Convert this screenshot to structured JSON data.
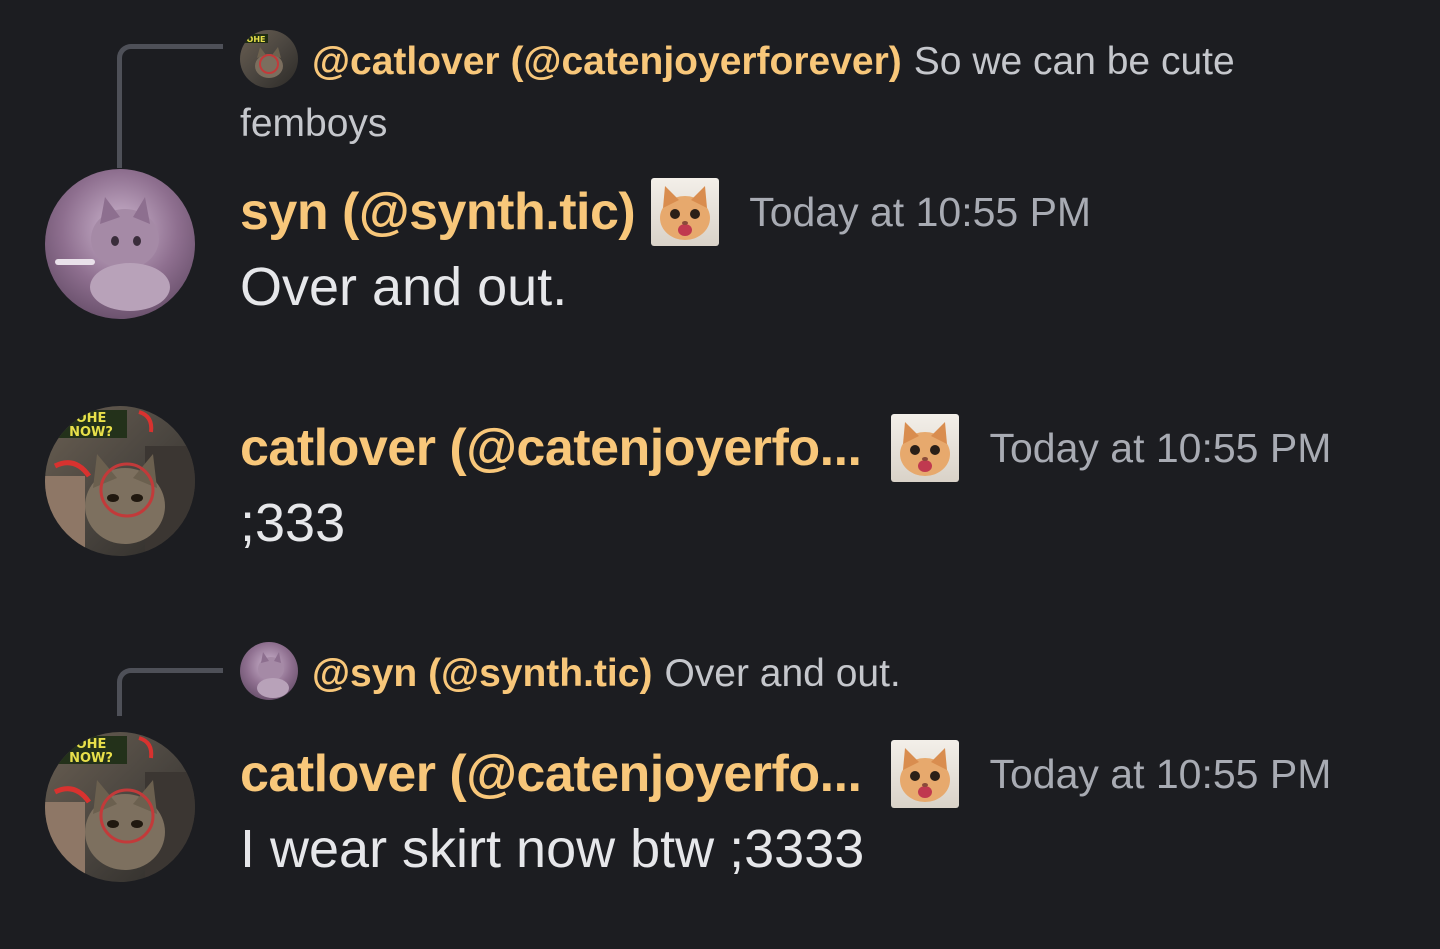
{
  "messages": [
    {
      "reply": {
        "author": "@catlover (@catenjoyerforever)",
        "text": "So we can be cute femboys"
      },
      "author": "syn (@synth.tic)",
      "timestamp": "Today at 10:55 PM",
      "text": "Over and out.",
      "avatar_icon": "kitten-avatar-icon",
      "role_icon": "cat-face-icon"
    },
    {
      "author": "catlover (@catenjoyerfo...",
      "timestamp": "Today at 10:55 PM",
      "text": ";333",
      "avatar_icon": "tabby-cat-avatar-icon",
      "avatar_caption": "OHE\nNOW?",
      "role_icon": "cat-face-icon"
    },
    {
      "reply": {
        "author": "@syn (@synth.tic)",
        "text": "Over and out."
      },
      "author": "catlover (@catenjoyerfo...",
      "timestamp": "Today at 10:55 PM",
      "text": "I wear skirt now btw ;3333",
      "avatar_icon": "tabby-cat-avatar-icon",
      "avatar_caption": "OHE\nNOW?",
      "role_icon": "cat-face-icon"
    }
  ],
  "colors": {
    "background": "#1c1d21",
    "username": "#f8c77a",
    "timestamp": "#a8abb3",
    "message_text": "#e6e7ea"
  }
}
